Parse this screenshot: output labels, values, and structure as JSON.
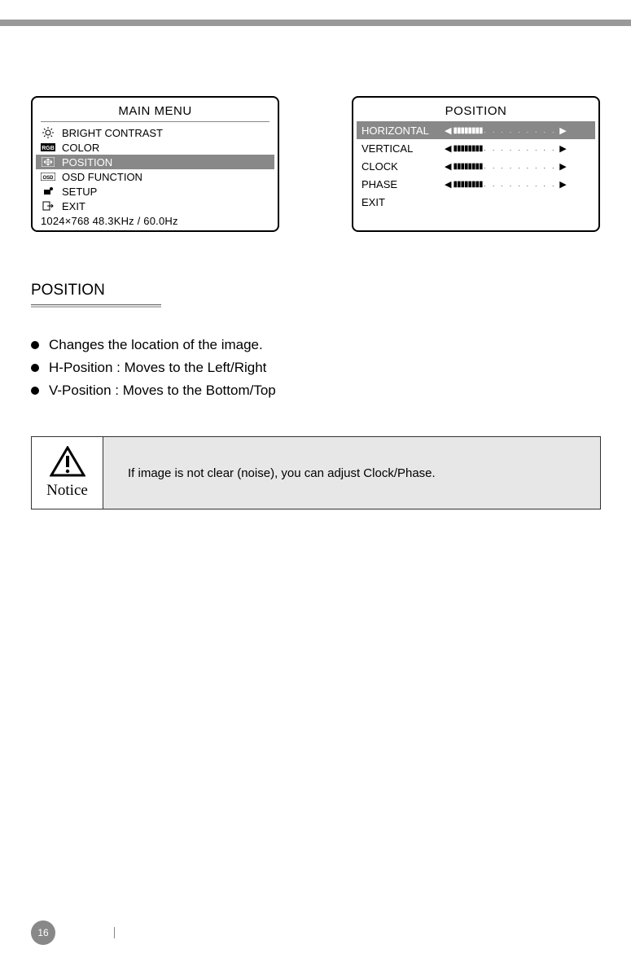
{
  "main_menu": {
    "title": "MAIN MENU",
    "items": [
      {
        "label": "BRIGHT  CONTRAST",
        "icon": "brightness-icon"
      },
      {
        "label": "COLOR",
        "icon": "rgb-icon"
      },
      {
        "label": "POSITION",
        "icon": "position-icon"
      },
      {
        "label": "OSD FUNCTION",
        "icon": "osd-icon"
      },
      {
        "label": "SETUP",
        "icon": "setup-icon"
      },
      {
        "label": "EXIT",
        "icon": "exit-icon"
      }
    ],
    "status": "1024×768    48.3KHz  /  60.0Hz"
  },
  "position_menu": {
    "title": "POSITION",
    "items": [
      {
        "label": "HORIZONTAL",
        "has_slider": true
      },
      {
        "label": "VERTICAL",
        "has_slider": true
      },
      {
        "label": "CLOCK",
        "has_slider": true
      },
      {
        "label": "PHASE",
        "has_slider": true
      },
      {
        "label": "EXIT",
        "has_slider": false
      }
    ]
  },
  "section": {
    "heading": "POSITION",
    "bullets": [
      "Changes the location of the image.",
      "H-Position : Moves to the Left/Right",
      "V-Position : Moves to the Bottom/Top"
    ]
  },
  "notice": {
    "label": "Notice",
    "text": "If image is not clear (noise), you can adjust Clock/Phase."
  },
  "page_number": "16"
}
